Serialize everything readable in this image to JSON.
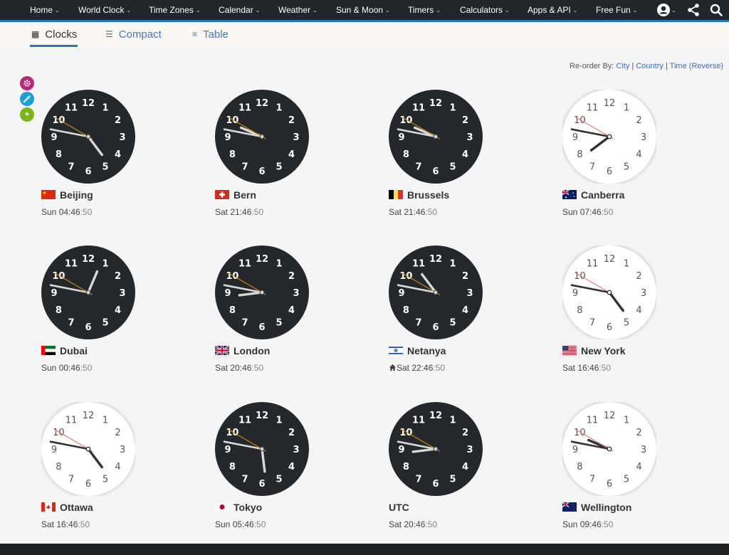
{
  "nav": {
    "items": [
      {
        "label": "Home",
        "name": "nav-home"
      },
      {
        "label": "World Clock",
        "name": "nav-world-clock"
      },
      {
        "label": "Time Zones",
        "name": "nav-time-zones"
      },
      {
        "label": "Calendar",
        "name": "nav-calendar"
      },
      {
        "label": "Weather",
        "name": "nav-weather"
      },
      {
        "label": "Sun & Moon",
        "name": "nav-sun-moon"
      },
      {
        "label": "Timers",
        "name": "nav-timers"
      },
      {
        "label": "Calculators",
        "name": "nav-calculators"
      },
      {
        "label": "Apps & API",
        "name": "nav-apps-api"
      },
      {
        "label": "Free Fun",
        "name": "nav-free-fun"
      }
    ],
    "icons": [
      "account-icon",
      "share-icon",
      "search-icon"
    ]
  },
  "tabs": [
    {
      "label": "Clocks",
      "icon": "grid-icon",
      "active": true
    },
    {
      "label": "Compact",
      "icon": "list-icon",
      "active": false
    },
    {
      "label": "Table",
      "icon": "table-icon",
      "active": false
    }
  ],
  "reorder": {
    "prefix": "Re-order By:",
    "sep": " | ",
    "city": "City",
    "country": "Country",
    "time": "Time",
    "reverse": "(Reverse)"
  },
  "side_buttons": [
    {
      "icon": "gear-icon",
      "color": "#c0237a"
    },
    {
      "icon": "pencil-icon",
      "color": "#1b9fd8"
    },
    {
      "icon": "plus-icon",
      "color": "#7cb518"
    }
  ],
  "colors": {
    "nav_bg": "#21262b",
    "accent": "#2a75c0",
    "dark_face": "#24272b",
    "light_face": "#ffffff",
    "dark_second_hand": "#d4860b",
    "light_second_hand": "#e87878"
  },
  "clocks": [
    {
      "city": "Beijing",
      "day": "Sun",
      "hm": "04:46",
      "sec": ":50",
      "hour": 4,
      "minute": 46,
      "second": 50,
      "face": "dark",
      "flag": "cn",
      "home": false
    },
    {
      "city": "Bern",
      "day": "Sat",
      "hm": "21:46",
      "sec": ":50",
      "hour": 21,
      "minute": 46,
      "second": 50,
      "face": "dark",
      "flag": "ch",
      "home": false
    },
    {
      "city": "Brussels",
      "day": "Sat",
      "hm": "21:46",
      "sec": ":50",
      "hour": 21,
      "minute": 46,
      "second": 50,
      "face": "dark",
      "flag": "be",
      "home": false
    },
    {
      "city": "Canberra",
      "day": "Sun",
      "hm": "07:46",
      "sec": ":50",
      "hour": 7,
      "minute": 46,
      "second": 50,
      "face": "light",
      "flag": "au",
      "home": false
    },
    {
      "city": "Dubai",
      "day": "Sun",
      "hm": "00:46",
      "sec": ":50",
      "hour": 0,
      "minute": 46,
      "second": 50,
      "face": "dark",
      "flag": "ae",
      "home": false
    },
    {
      "city": "London",
      "day": "Sat",
      "hm": "20:46",
      "sec": ":50",
      "hour": 20,
      "minute": 46,
      "second": 50,
      "face": "dark",
      "flag": "gb",
      "home": false
    },
    {
      "city": "Netanya",
      "day": "Sat",
      "hm": "22:46",
      "sec": ":50",
      "hour": 22,
      "minute": 46,
      "second": 50,
      "face": "dark",
      "flag": "il",
      "home": true
    },
    {
      "city": "New York",
      "day": "Sat",
      "hm": "16:46",
      "sec": ":50",
      "hour": 16,
      "minute": 46,
      "second": 50,
      "face": "light",
      "flag": "us",
      "home": false
    },
    {
      "city": "Ottawa",
      "day": "Sat",
      "hm": "16:46",
      "sec": ":50",
      "hour": 16,
      "minute": 46,
      "second": 50,
      "face": "light",
      "flag": "ca",
      "home": false
    },
    {
      "city": "Tokyo",
      "day": "Sun",
      "hm": "05:46",
      "sec": ":50",
      "hour": 5,
      "minute": 46,
      "second": 50,
      "face": "dark",
      "flag": "jp",
      "home": false
    },
    {
      "city": "UTC",
      "day": "Sat",
      "hm": "20:46",
      "sec": ":50",
      "hour": 20,
      "minute": 46,
      "second": 50,
      "face": "dark",
      "flag": "",
      "home": false
    },
    {
      "city": "Wellington",
      "day": "Sun",
      "hm": "09:46",
      "sec": ":50",
      "hour": 9,
      "minute": 46,
      "second": 50,
      "face": "light",
      "flag": "nz",
      "home": false
    }
  ]
}
